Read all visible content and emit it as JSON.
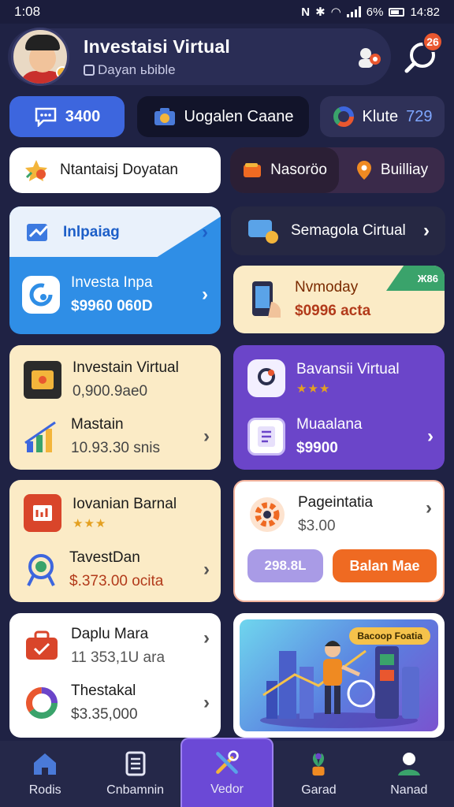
{
  "status": {
    "time": "1:08",
    "battery": "6%",
    "clock": "14:82"
  },
  "header": {
    "title": "Investaisi Virtual",
    "subtitle": "Dayan ьbible",
    "badge": "26"
  },
  "chips": [
    {
      "label": "3400",
      "icon": "chat-icon"
    },
    {
      "label": "Uogalen Caane",
      "icon": "camera-icon"
    },
    {
      "label": "Klute",
      "num": "729",
      "icon": "donut-chart-icon"
    }
  ],
  "pills": {
    "left": "Ntantaisj Doyatan",
    "segA": "Nasoröo",
    "segB": "Builliay"
  },
  "cards": {
    "blue": {
      "top_title": "Inlpaiag",
      "title": "Investa Inpa",
      "amount": "$9960 060D"
    },
    "dark": {
      "title": "Semagola Cirtual"
    },
    "cream1": {
      "ribbon": "Ж86",
      "title": "Nvmoday",
      "amount": "$0996 acta"
    },
    "l2": {
      "title1": "Investain Virtual",
      "sub1": "0,900.9ae0",
      "title2": "Mastain",
      "amount2": "10.93.30 snis"
    },
    "purple": {
      "title1": "Bavansii Virtual",
      "title2": "Muaalana",
      "amount2": "$9900"
    },
    "l3": {
      "title1": "Iovanian Barnal",
      "title2": "TavestDan",
      "amount2": "$.373.00 ocita"
    },
    "white": {
      "title": "Pageintatia",
      "amount": "$3.00",
      "btn1": "298.8L",
      "btn2": "Balan Mae"
    },
    "l4": {
      "title1": "Daplu Mara",
      "sub1": "11 353,1U ara",
      "title2": "Thestakal",
      "amount2": "$3.35,000"
    },
    "illus": {
      "tag": "Bacoop Foatia"
    }
  },
  "nav": [
    {
      "label": "Rodis",
      "icon": "home-icon"
    },
    {
      "label": "Cnbamnin",
      "icon": "document-icon"
    },
    {
      "label": "Vedor",
      "icon": "tools-icon",
      "active": true
    },
    {
      "label": "Garad",
      "icon": "plant-icon"
    },
    {
      "label": "Nanad",
      "icon": "profile-icon"
    }
  ],
  "colors": {
    "background": "#1f2244",
    "accent": "#6b49d6",
    "blue": "#2f8ee6",
    "orange": "#ef6a22",
    "cream": "#fbebc6"
  }
}
